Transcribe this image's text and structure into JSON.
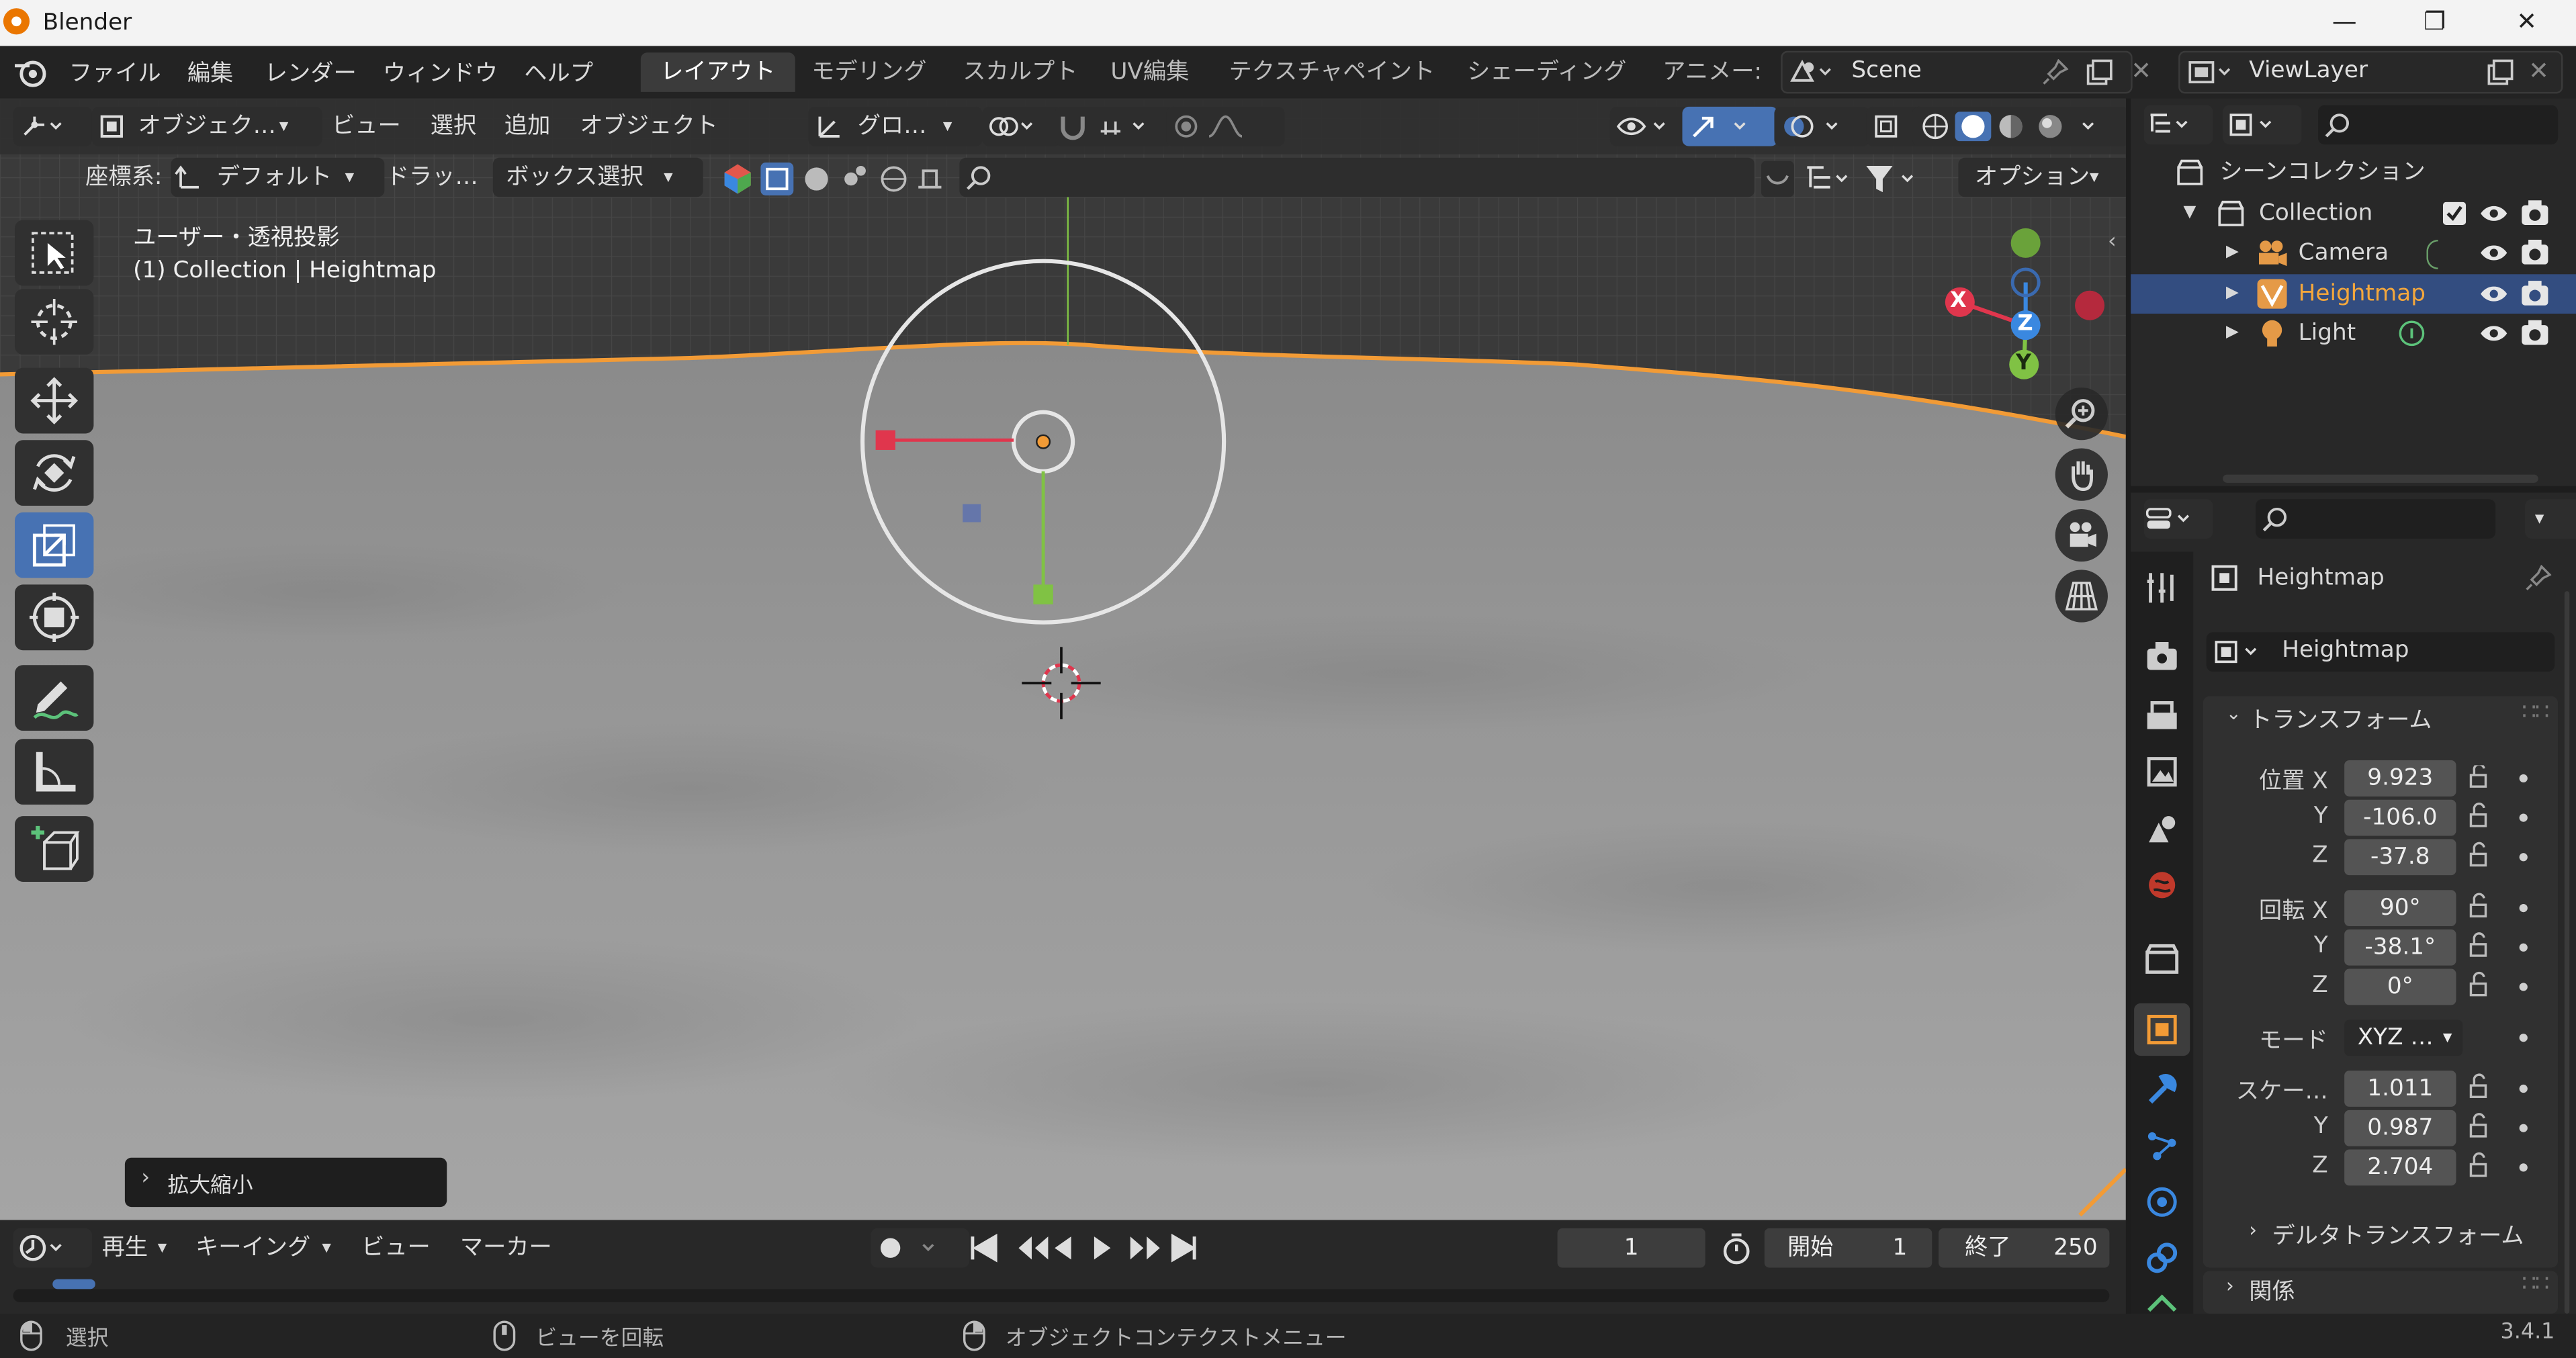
{
  "window": {
    "title": "Blender",
    "minimize_glyph": "—",
    "maximize_glyph": "❐",
    "close_glyph": "✕"
  },
  "menubar": {
    "menus": [
      "ファイル",
      "編集",
      "レンダー",
      "ウィンドウ",
      "ヘルプ"
    ],
    "workspaces": [
      "レイアウト",
      "モデリング",
      "スカルプト",
      "UV編集",
      "テクスチャペイント",
      "シェーディング",
      "アニメー:"
    ],
    "active_workspace": "レイアウト",
    "scene": "Scene",
    "view_layer": "ViewLayer"
  },
  "viewport": {
    "mode": "オブジェク…",
    "menus": [
      "ビュー",
      "選択",
      "追加",
      "オブジェクト"
    ],
    "transform_orientation": "グロ…",
    "coordinate_label": "座標系:",
    "coordinate_value": "デフォルト",
    "drag_label": "ドラッ…",
    "drag_value": "ボックス選択",
    "options": "オプション",
    "view_name": "ユーザー・透視投影",
    "object_info": "(1) Collection | Heightmap",
    "last_operator": "拡大縮小",
    "gizmo": {
      "x": "X",
      "y": "Y",
      "z": "Z"
    }
  },
  "timeline": {
    "menus": [
      "再生",
      "キーイング",
      "ビュー",
      "マーカー"
    ],
    "current_frame": "1",
    "start_label": "開始",
    "start": "1",
    "end_label": "終了",
    "end": "250"
  },
  "statusbar": {
    "left": "選択",
    "middle": "ビューを回転",
    "right": "オブジェクトコンテクストメニュー",
    "version": "3.4.1"
  },
  "outliner": {
    "scene_collection": "シーンコレクション",
    "collection": "Collection",
    "items": [
      {
        "name": "Camera",
        "selected": false
      },
      {
        "name": "Heightmap",
        "selected": true
      },
      {
        "name": "Light",
        "selected": false
      }
    ]
  },
  "properties": {
    "object_name": "Heightmap",
    "data_name": "Heightmap",
    "transform_header": "トランスフォーム",
    "location_label": "位置 X",
    "location": [
      "9.923",
      "-106.0",
      "-37.8"
    ],
    "rotation_label": "回転 X",
    "rotation": [
      "90°",
      "-38.1°",
      "0°"
    ],
    "mode_label": "モード",
    "mode": "XYZ …",
    "scale_label": "スケー…",
    "scale": [
      "1.011",
      "0.987",
      "2.704"
    ],
    "axis_y": "Y",
    "axis_z": "Z",
    "delta_transform": "デルタトランスフォーム",
    "relations": "関係"
  },
  "colors": {
    "accent": "#4772b3",
    "selection": "#334d80",
    "orange": "#f29b36",
    "x_axis": "#e0364d",
    "y_axis": "#80c244",
    "z_axis": "#3a88e0"
  }
}
